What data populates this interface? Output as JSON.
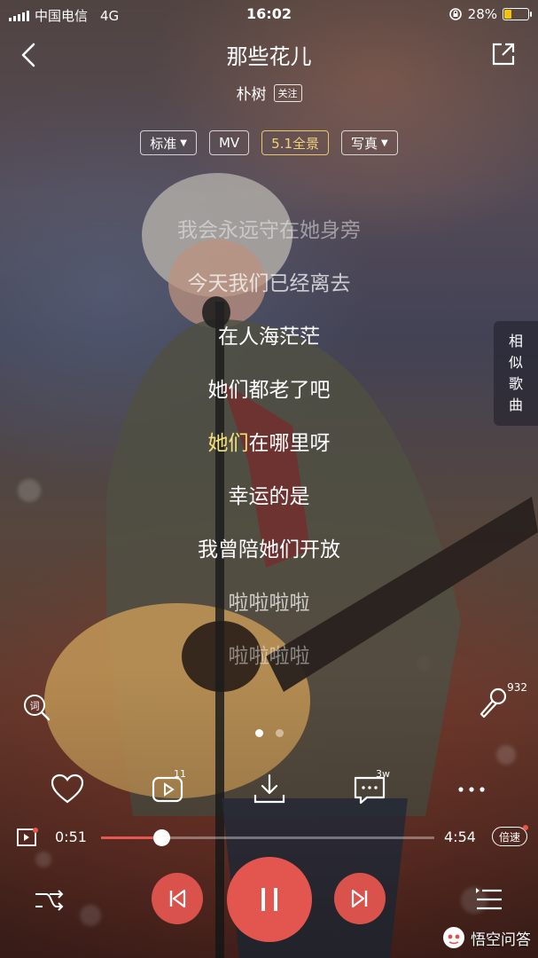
{
  "status": {
    "carrier": "中国电信",
    "network": "4G",
    "time": "16:02",
    "battery": "28%",
    "battery_level": 0.28
  },
  "header": {
    "title": "那些花儿",
    "artist": "朴树",
    "follow": "关注"
  },
  "chips": [
    {
      "label": "标准",
      "dropdown": true
    },
    {
      "label": "MV",
      "dropdown": false
    },
    {
      "label": "5.1全景",
      "dropdown": false,
      "accent": "#f1d27a"
    },
    {
      "label": "写真",
      "dropdown": true
    }
  ],
  "lyrics": {
    "lines": [
      "我会永远守在她身旁",
      "今天我们已经离去",
      "在人海茫茫",
      "她们都老了吧",
      "她们在哪里呀",
      "幸运的是",
      "我曾陪她们开放",
      "啦啦啦啦",
      "啦啦啦啦"
    ],
    "active_highlight": "她们",
    "active_rest": "在哪里呀"
  },
  "side_tab": {
    "chars": [
      "相",
      "似",
      "歌",
      "曲"
    ]
  },
  "karaoke": {
    "count": "932"
  },
  "actions": {
    "comment_count": "11",
    "share_count": "3w"
  },
  "player": {
    "current": "0:51",
    "total": "4:54",
    "progress": 0.18,
    "speed_label": "倍速",
    "accent": "#e2564f"
  },
  "watermark": {
    "text": "悟空问答"
  }
}
